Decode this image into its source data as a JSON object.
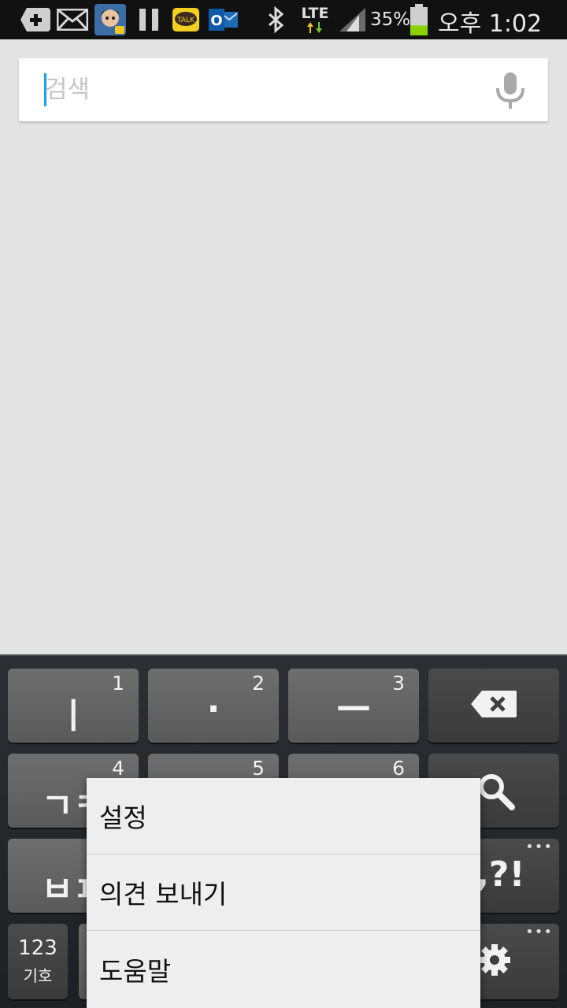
{
  "status_bar": {
    "battery_percent": "35%",
    "time": "오후 1:02",
    "network": "LTE",
    "kakao_label": "TALK",
    "outlook_label": "O",
    "battery_level": 0.35,
    "icons": [
      "add-notification-icon",
      "mail-icon",
      "game-avatar-icon",
      "pause-icon",
      "kakaotalk-icon",
      "outlook-icon",
      "bluetooth-icon",
      "lte-icon",
      "signal-icon",
      "battery-icon"
    ]
  },
  "search": {
    "placeholder": "검색",
    "value": "",
    "cursor_color": "#1aa3e8"
  },
  "keyboard": {
    "row1": [
      {
        "label": "ㅣ",
        "num": "1"
      },
      {
        "label": "·",
        "num": "2"
      },
      {
        "label": "—",
        "num": "3"
      },
      {
        "label": "backspace-icon",
        "num": ""
      }
    ],
    "row2": [
      {
        "label": "ㄱㅋ",
        "num": "4"
      },
      {
        "label": "",
        "num": "5"
      },
      {
        "label": "",
        "num": "6"
      },
      {
        "label": "search-icon",
        "num": ""
      }
    ],
    "row3": [
      {
        "label": "ㅂㅍ",
        "num": ""
      },
      {
        "label": ".,?!",
        "num": ""
      }
    ],
    "row4": [
      {
        "label_top": "123",
        "label_bottom": "기호"
      },
      {
        "label": "settings-icon"
      }
    ],
    "more_indicator": "•••"
  },
  "popup_menu": {
    "items": [
      "설정",
      "의견 보내기",
      "도움말"
    ]
  },
  "colors": {
    "background": "#e4e4e4",
    "statusbar": "#111111",
    "battery_green": "#8bd100",
    "keyboard_bg": "#25282b"
  }
}
